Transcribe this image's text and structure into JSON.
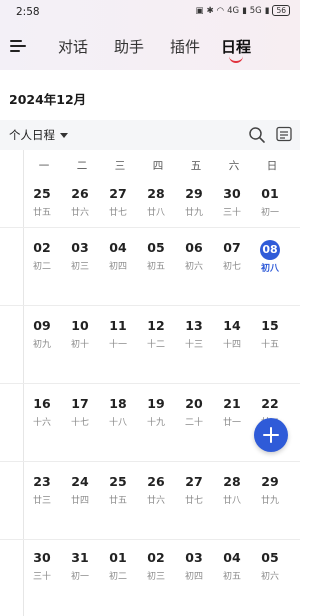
{
  "status_bar": {
    "time": "2:58",
    "signal_a": "4G",
    "signal_b": "5G",
    "battery": "56"
  },
  "nav": {
    "tabs": [
      {
        "label": "对话",
        "active": false
      },
      {
        "label": "助手",
        "active": false
      },
      {
        "label": "插件",
        "active": false
      },
      {
        "label": "日程",
        "active": true
      }
    ],
    "accent_color": "#e0313d"
  },
  "month_title": "2024年12月",
  "filter": {
    "calendar_label": "个人日程"
  },
  "weekdays": [
    "一",
    "二",
    "三",
    "四",
    "五",
    "六",
    "日"
  ],
  "weeks": [
    [
      {
        "day": "25",
        "lunar": "廿五"
      },
      {
        "day": "26",
        "lunar": "廿六"
      },
      {
        "day": "27",
        "lunar": "廿七"
      },
      {
        "day": "28",
        "lunar": "廿八"
      },
      {
        "day": "29",
        "lunar": "廿九"
      },
      {
        "day": "30",
        "lunar": "三十"
      },
      {
        "day": "01",
        "lunar": "初一"
      }
    ],
    [
      {
        "day": "02",
        "lunar": "初二"
      },
      {
        "day": "03",
        "lunar": "初三"
      },
      {
        "day": "04",
        "lunar": "初四"
      },
      {
        "day": "05",
        "lunar": "初五"
      },
      {
        "day": "06",
        "lunar": "初六"
      },
      {
        "day": "07",
        "lunar": "初七"
      },
      {
        "day": "08",
        "lunar": "初八",
        "today": true
      }
    ],
    [
      {
        "day": "09",
        "lunar": "初九"
      },
      {
        "day": "10",
        "lunar": "初十"
      },
      {
        "day": "11",
        "lunar": "十一"
      },
      {
        "day": "12",
        "lunar": "十二"
      },
      {
        "day": "13",
        "lunar": "十三"
      },
      {
        "day": "14",
        "lunar": "十四"
      },
      {
        "day": "15",
        "lunar": "十五"
      }
    ],
    [
      {
        "day": "16",
        "lunar": "十六"
      },
      {
        "day": "17",
        "lunar": "十七"
      },
      {
        "day": "18",
        "lunar": "十八"
      },
      {
        "day": "19",
        "lunar": "十九"
      },
      {
        "day": "20",
        "lunar": "二十"
      },
      {
        "day": "21",
        "lunar": "廿一"
      },
      {
        "day": "22",
        "lunar": "廿二"
      }
    ],
    [
      {
        "day": "23",
        "lunar": "廿三"
      },
      {
        "day": "24",
        "lunar": "廿四"
      },
      {
        "day": "25",
        "lunar": "廿五"
      },
      {
        "day": "26",
        "lunar": "廿六"
      },
      {
        "day": "27",
        "lunar": "廿七"
      },
      {
        "day": "28",
        "lunar": "廿八"
      },
      {
        "day": "29",
        "lunar": "廿九"
      }
    ],
    [
      {
        "day": "30",
        "lunar": "三十"
      },
      {
        "day": "31",
        "lunar": "初一"
      },
      {
        "day": "01",
        "lunar": "初二"
      },
      {
        "day": "02",
        "lunar": "初三"
      },
      {
        "day": "03",
        "lunar": "初四"
      },
      {
        "day": "04",
        "lunar": "初五"
      },
      {
        "day": "05",
        "lunar": "初六"
      }
    ]
  ],
  "today_color": "#2f5bd8",
  "icons": {
    "menu": "menu-icon",
    "search": "search-icon",
    "view": "calendar-view-icon",
    "add": "plus-icon"
  }
}
